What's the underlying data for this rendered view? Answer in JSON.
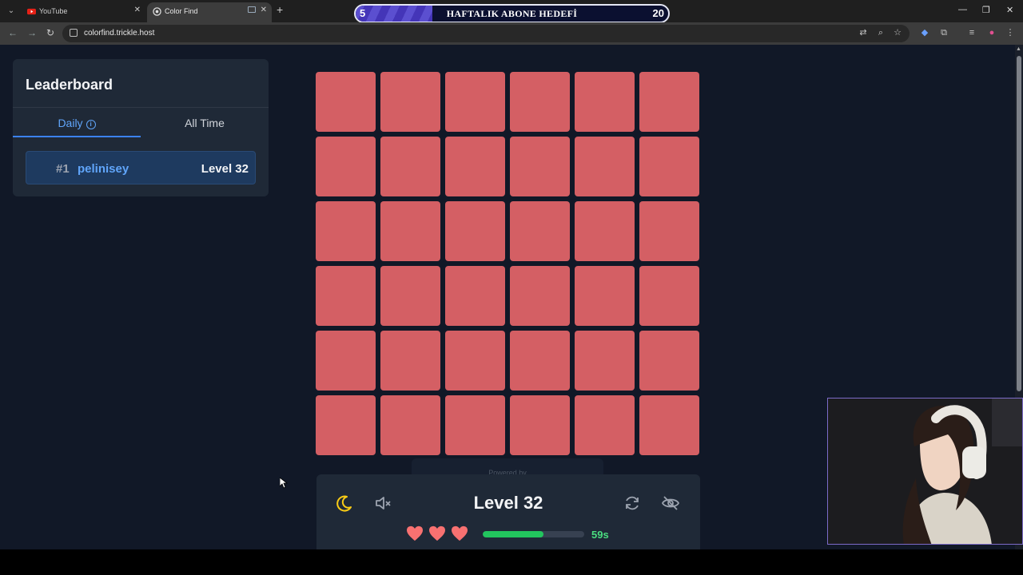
{
  "browser": {
    "tabs": [
      {
        "title": "YouTube",
        "active": false
      },
      {
        "title": "Color Find",
        "active": true
      }
    ],
    "url": "colorfind.trickle.host"
  },
  "overlay": {
    "goal_title": "HAFTALIK ABONE HEDEFİ",
    "goal_start": "5",
    "goal_end": "20"
  },
  "leaderboard": {
    "title": "Leaderboard",
    "tabs": [
      "Daily",
      "All Time"
    ],
    "active_tab": "Daily",
    "entries": [
      {
        "rank": "#1",
        "name": "pelinisey",
        "level": "Level 32"
      }
    ]
  },
  "game": {
    "grid_rows": 6,
    "grid_cols": 6,
    "tile_color": "#d45f64",
    "powered_by": "Powered by",
    "level_label": "Level 32",
    "lives": 3,
    "time_remaining": "59s",
    "time_progress": 0.6,
    "icons": [
      "moon-icon",
      "mute-icon",
      "restart-icon",
      "eye-off-icon",
      "heart-icon"
    ]
  },
  "colors": {
    "accent": "#60a5fa",
    "heart": "#f87171",
    "timer": "#4ade80",
    "panel": "#1f2937",
    "background": "#111827"
  }
}
